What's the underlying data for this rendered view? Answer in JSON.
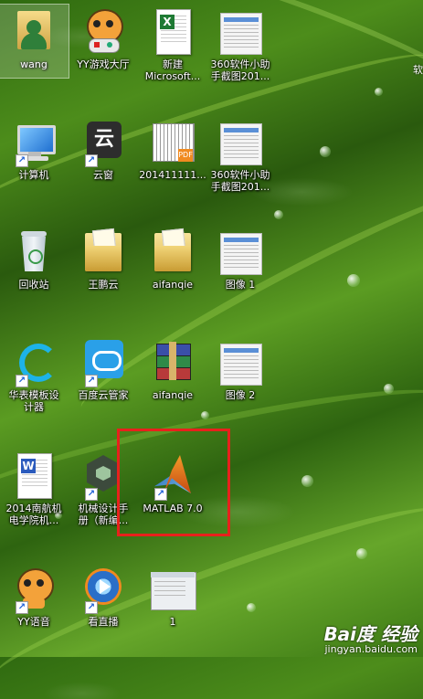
{
  "desktop": {
    "icons": [
      {
        "name": "wang",
        "type": "user-folder-icon"
      },
      {
        "name": "YY游戏大厅",
        "type": "yy-game-icon"
      },
      {
        "name": "新建\nMicrosoft...",
        "type": "excel-file-icon"
      },
      {
        "name": "360软件小助\n手截图201...",
        "type": "screenshot-file-icon"
      },
      {
        "name": "计算机",
        "type": "computer-icon"
      },
      {
        "name": "云窗",
        "type": "yunchuang-icon"
      },
      {
        "name": "201411111...",
        "type": "spreadsheet-image-icon"
      },
      {
        "name": "360软件小助\n手截图201...",
        "type": "screenshot-file-icon"
      },
      {
        "name": "回收站",
        "type": "recycle-bin-icon"
      },
      {
        "name": "王鹏云",
        "type": "folder-icon"
      },
      {
        "name": "aifanqie",
        "type": "folder-icon"
      },
      {
        "name": "图像 1",
        "type": "screenshot-file-icon"
      },
      {
        "name": "华表模板设\n计器",
        "type": "huabiao-icon"
      },
      {
        "name": "百度云管家",
        "type": "baidu-cloud-icon"
      },
      {
        "name": "aifanqie",
        "type": "winrar-archive-icon"
      },
      {
        "name": "图像 2",
        "type": "screenshot-file-icon"
      },
      {
        "name": "2014南航机\n电学院机...",
        "type": "word-doc-icon"
      },
      {
        "name": "机械设计手\n册（新编...",
        "type": "mechanical-handbook-icon"
      },
      {
        "name": "MATLAB 7.0",
        "type": "matlab-icon"
      },
      {
        "name": "YY语音",
        "type": "yy-voice-icon"
      },
      {
        "name": "看直播",
        "type": "live-tv-icon"
      },
      {
        "name": "1",
        "type": "window-screenshot-icon"
      }
    ]
  },
  "edge_text": "软",
  "watermark": {
    "logo": "Bai度 经验",
    "url": "jingyan.baidu.com"
  },
  "colors": {
    "highlight": "#e8211c",
    "grass": "#3b7814"
  }
}
